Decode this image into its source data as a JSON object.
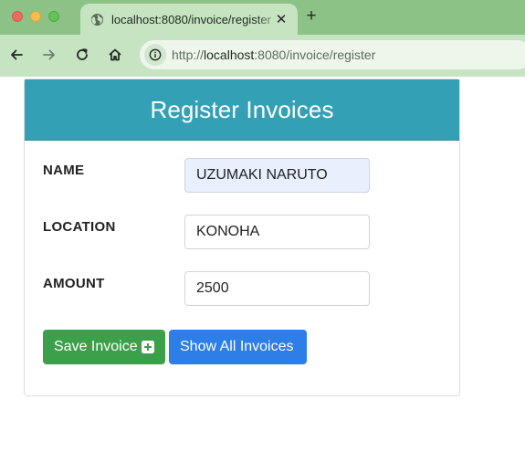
{
  "browser": {
    "tab_title": "localhost:8080/invoice/register",
    "url_host": "localhost",
    "url_rest": ":8080/invoice/register",
    "url_scheme": "http://",
    "new_tab_symbol": "+",
    "close_symbol": "✕",
    "tab_background": "#c6e3c2",
    "frame_color": "#8dc287"
  },
  "card": {
    "title": "Register Invoices",
    "header_color": "#33a0b5"
  },
  "form": {
    "name_label": "NAME",
    "name_value": "UZUMAKI NARUTO",
    "location_label": "LOCATION",
    "location_value": "KONOHA",
    "amount_label": "AMOUNT",
    "amount_value": "2500"
  },
  "actions": {
    "save_label": "Save Invoice",
    "save_icon": "plus-square-icon",
    "save_color": "#3ca04a",
    "show_label": "Show All Invoices",
    "show_color": "#2d7ee6"
  },
  "icons": {
    "tab_favicon": "globe-icon",
    "back": "arrow-left-icon",
    "forward": "arrow-right-icon",
    "reload": "reload-icon",
    "home": "home-icon",
    "site_info": "info-icon"
  }
}
